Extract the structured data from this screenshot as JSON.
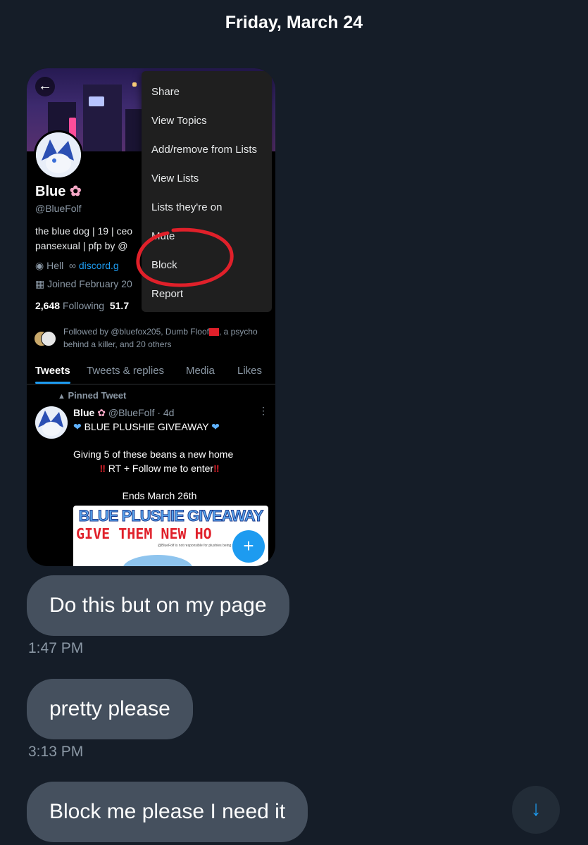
{
  "date_header": "Friday, March 24",
  "profile": {
    "name": "Blue",
    "handle": "@BlueFolf",
    "bio_line1": "the blue dog | 19 | ceo",
    "bio_line2": "pansexual | pfp by @",
    "location": "Hell",
    "link": "discord.g",
    "joined": "Joined February 20",
    "following_count": "2,648",
    "following_label": "Following",
    "followers_count": "51.7",
    "followed_by_prefix": "Followed by @bluefox205, Dumb Floof",
    "followed_by_suffix": ", a psycho behind a killer, and 20 others"
  },
  "tabs": [
    "Tweets",
    "Tweets & replies",
    "Media",
    "Likes"
  ],
  "pinned_tweet": {
    "pinned_label": "Pinned Tweet",
    "author": "Blue",
    "handle_time": "@BlueFolf · 4d",
    "title": "BLUE PLUSHIE GIVEAWAY",
    "line1": "Giving 5 of these beans a new home",
    "line2": "RT + Follow me to enter",
    "line3": "Ends March 26th",
    "image_title": "BLUE PLUSHIE GIVEAWAY",
    "image_sub": "GIVE THEM NEW HO",
    "image_fine": "@BlueFolf is not responsible for plushies being poisonous"
  },
  "menu": [
    "Share",
    "View Topics",
    "Add/remove from Lists",
    "View Lists",
    "Lists they're on",
    "Mute",
    "Block",
    "Report"
  ],
  "messages": [
    {
      "text": "Do this but on my page",
      "time": "1:47 PM"
    },
    {
      "text": "pretty please",
      "time": "3:13 PM"
    },
    {
      "text": "Block me please I need it",
      "time": ""
    }
  ],
  "colors": {
    "background": "#151d28",
    "bubble": "#45505e",
    "accent": "#1d9bf0",
    "annotation_circle": "#e0202a"
  },
  "icons": {
    "back": "arrow-left-icon",
    "location": "pin-icon",
    "link": "link-icon",
    "calendar": "calendar-icon",
    "compose": "plus-icon",
    "scroll": "arrow-down-icon"
  }
}
